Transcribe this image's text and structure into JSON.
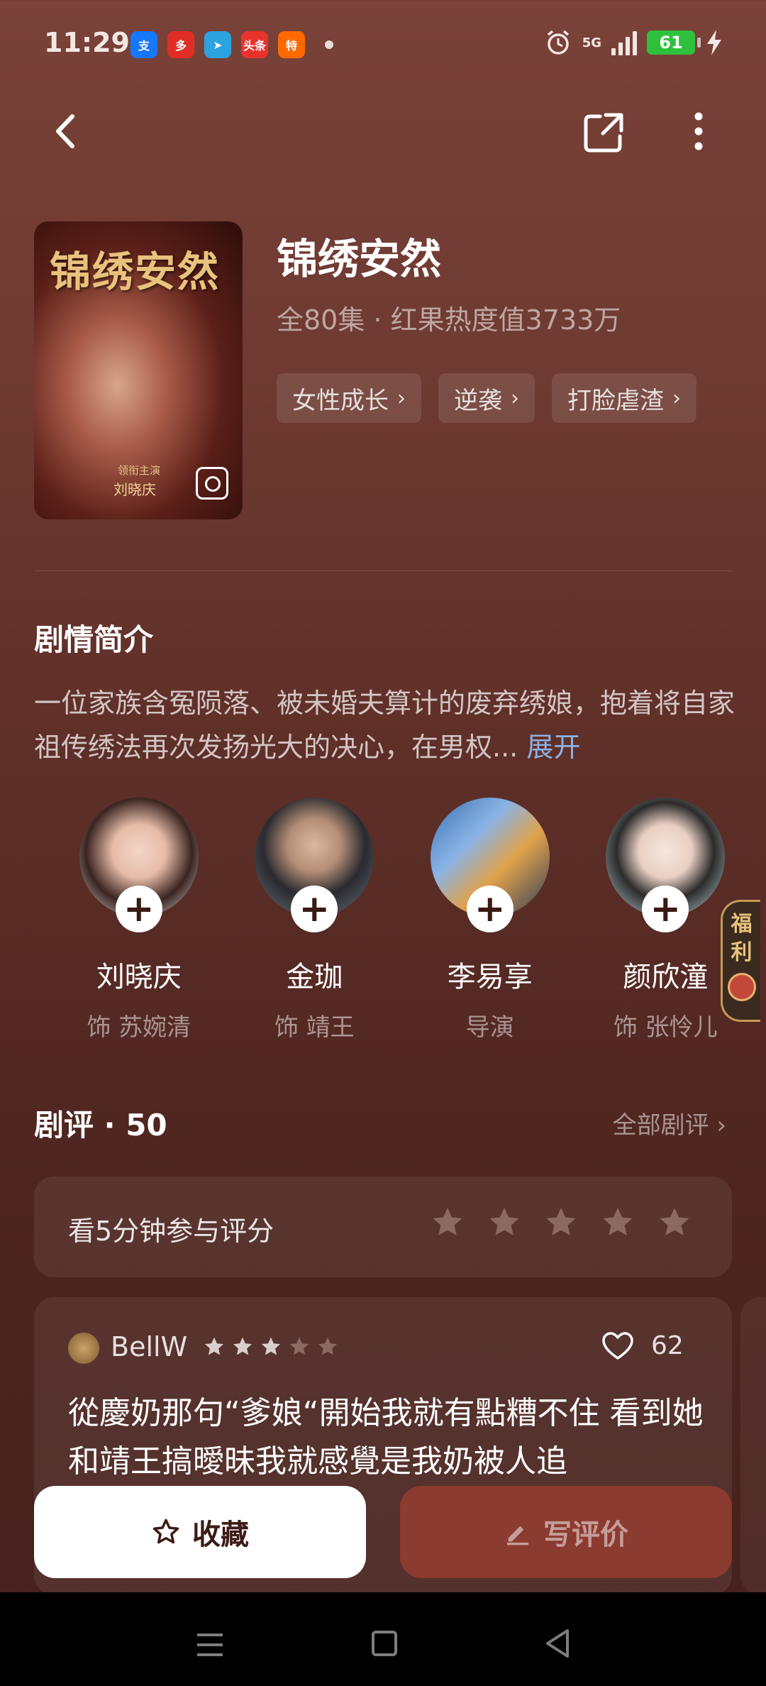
{
  "status_bar": {
    "time": "11:29",
    "app_icons": [
      {
        "name": "alipay-icon",
        "label": "支",
        "color": "#1677ff"
      },
      {
        "name": "pinduoduo-icon",
        "label": "多",
        "color": "#e02e24"
      },
      {
        "name": "telegram-icon",
        "label": "➤",
        "color": "#2aa3df"
      },
      {
        "name": "toutiao-icon",
        "label": "头条",
        "color": "#e8332b"
      },
      {
        "name": "taobao-special-icon",
        "label": "特",
        "color": "#ff6a00"
      }
    ],
    "network": "5G",
    "battery": "61"
  },
  "nav": {
    "back_icon": "chevron-left-icon",
    "share_icon": "share-icon",
    "more_icon": "more-vertical-icon"
  },
  "show": {
    "poster_title": "锦绣安然",
    "poster_sub": "领衔主演",
    "poster_actor": "刘晓庆",
    "title": "锦绣安然",
    "meta": "全80集 · 红果热度值3733万",
    "tags": [
      "女性成长",
      "逆袭",
      "打脸虐渣"
    ]
  },
  "synopsis": {
    "heading": "剧情简介",
    "text": "一位家族含冤陨落、被未婚夫算计的废弃绣娘，抱着将自家祖传绣法再次发扬光大的决心，在男权...",
    "expand": "展开"
  },
  "cast": [
    {
      "name": "刘晓庆",
      "role": "饰 苏婉清"
    },
    {
      "name": "金珈",
      "role": "饰 靖王"
    },
    {
      "name": "李易享",
      "role": "导演"
    },
    {
      "name": "颜欣潼",
      "role": "饰 张怜儿"
    }
  ],
  "welfare": {
    "line1": "福",
    "line2": "利"
  },
  "reviews": {
    "heading": "剧评 · 50",
    "all_label": "全部剧评",
    "rate_prompt": "看5分钟参与评分",
    "rate_star_count": 5,
    "card": {
      "user": "BellW",
      "rating": 3,
      "likes": "62",
      "text": "從慶奶那句“爹娘“開始我就有點糟不住 看到她和靖王搞曖昧我就感覺是我奶被人追"
    }
  },
  "actions": {
    "collect": "收藏",
    "write_review": "写评价"
  },
  "colors": {
    "accent_blue": "#8fb0e6",
    "review_button": "#8b3b30",
    "star_filled": "#d9cfcc",
    "star_empty": "#8c6a63"
  }
}
